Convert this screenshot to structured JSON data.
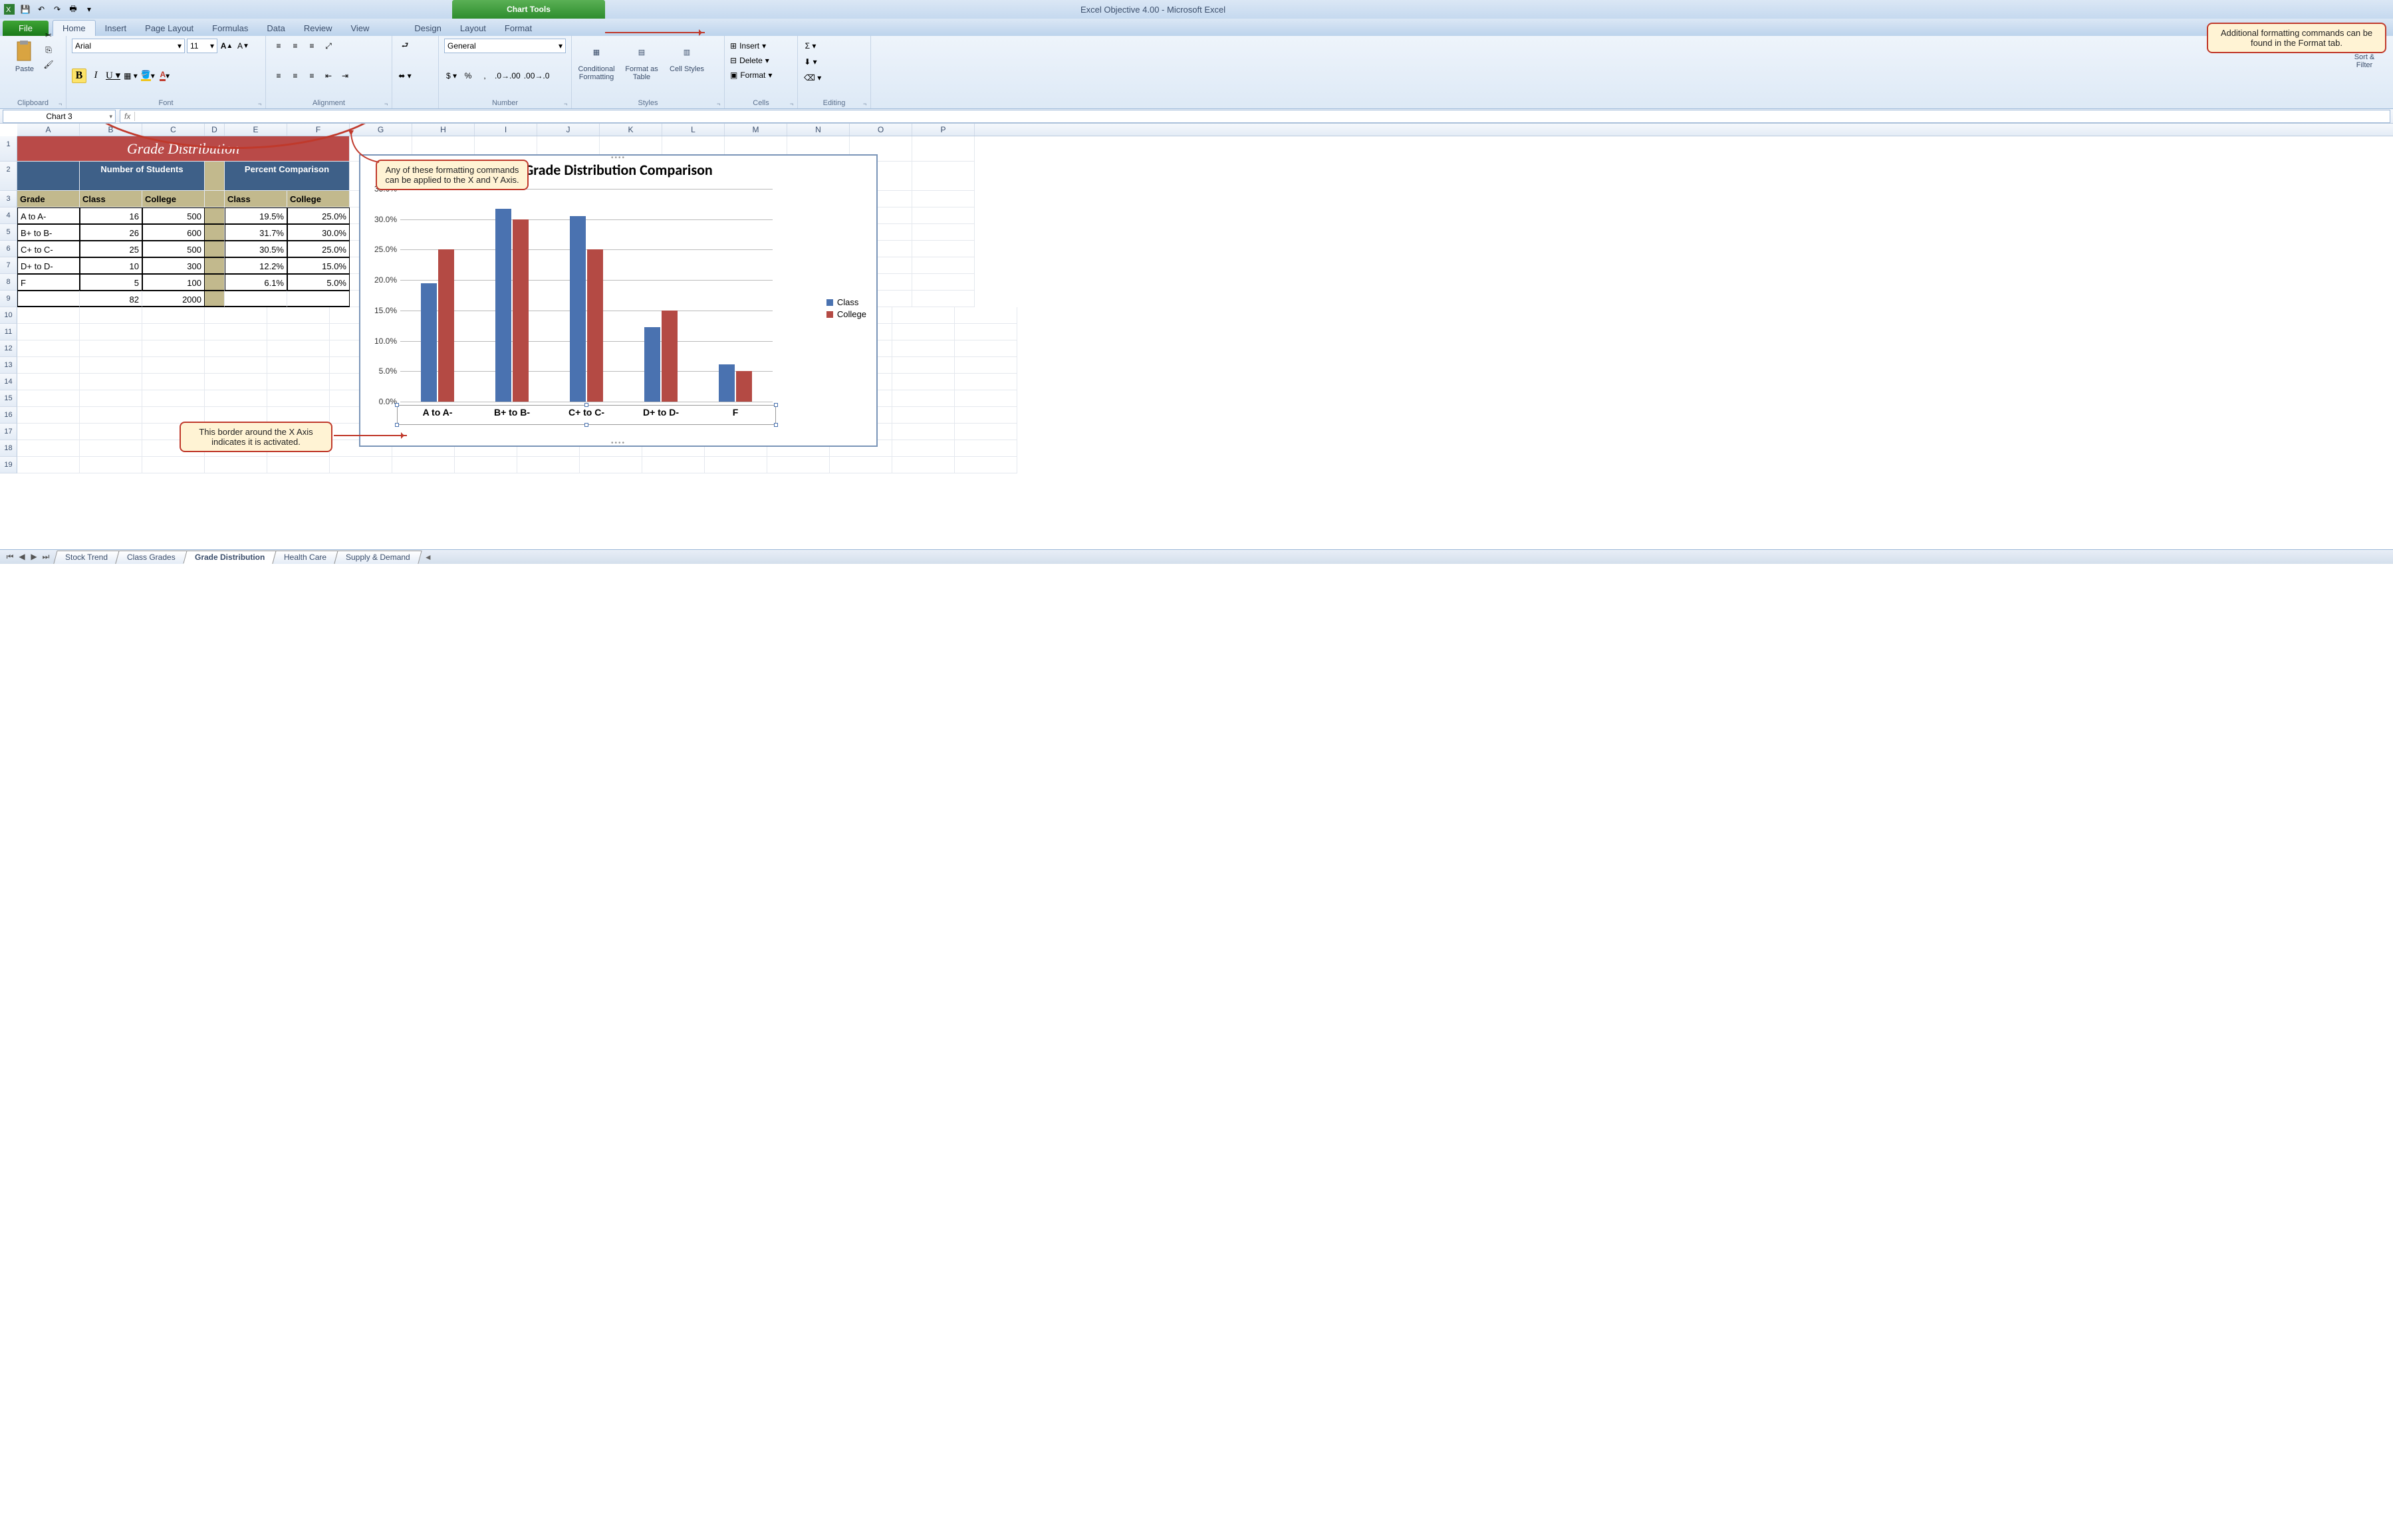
{
  "app": {
    "title": "Excel Objective 4.00  -  Microsoft Excel",
    "contextual_tab_group": "Chart Tools"
  },
  "qat": {
    "save": "💾",
    "undo": "↶",
    "redo": "↷",
    "print": "🖶"
  },
  "tabs": {
    "file": "File",
    "home": "Home",
    "insert": "Insert",
    "page_layout": "Page Layout",
    "formulas": "Formulas",
    "data": "Data",
    "review": "Review",
    "view": "View",
    "design": "Design",
    "layout": "Layout",
    "format": "Format"
  },
  "ribbon": {
    "clipboard": {
      "paste": "Paste",
      "label": "Clipboard"
    },
    "font": {
      "name": "Arial",
      "size": "11",
      "label": "Font"
    },
    "alignment": {
      "label": "Alignment"
    },
    "number": {
      "format": "General",
      "label": "Number"
    },
    "styles": {
      "cf": "Conditional Formatting",
      "fat": "Format as Table",
      "cs": "Cell Styles",
      "label": "Styles"
    },
    "cells": {
      "insert": "Insert",
      "delete": "Delete",
      "format": "Format",
      "label": "Cells"
    },
    "editing": {
      "sort": "Sort & Filter",
      "label": "Editing"
    }
  },
  "namebox": "Chart 3",
  "cols": [
    "A",
    "B",
    "C",
    "D",
    "E",
    "F",
    "G",
    "H",
    "I",
    "J",
    "K",
    "L",
    "M",
    "N",
    "O",
    "P"
  ],
  "table": {
    "title": "Grade Distribution",
    "hdr_num": "Number of Students",
    "hdr_pct": "Percent Comparison",
    "sub": {
      "grade": "Grade",
      "class": "Class",
      "college": "College"
    },
    "rows": [
      {
        "g": "A to A-",
        "nc": "16",
        "ncol": "500",
        "pc": "19.5%",
        "pcol": "25.0%"
      },
      {
        "g": "B+ to B-",
        "nc": "26",
        "ncol": "600",
        "pc": "31.7%",
        "pcol": "30.0%"
      },
      {
        "g": "C+ to C-",
        "nc": "25",
        "ncol": "500",
        "pc": "30.5%",
        "pcol": "25.0%"
      },
      {
        "g": "D+ to D-",
        "nc": "10",
        "ncol": "300",
        "pc": "12.2%",
        "pcol": "15.0%"
      },
      {
        "g": "F",
        "nc": "5",
        "ncol": "100",
        "pc": "6.1%",
        "pcol": "5.0%"
      }
    ],
    "total": {
      "nc": "82",
      "ncol": "2000"
    }
  },
  "chart_data": {
    "type": "bar",
    "title": "Grade Distribution  Comparison",
    "categories": [
      "A to A-",
      "B+ to B-",
      "C+ to C-",
      "D+ to D-",
      "F"
    ],
    "series": [
      {
        "name": "Class",
        "values": [
          19.5,
          31.7,
          30.5,
          12.2,
          6.1
        ]
      },
      {
        "name": "College",
        "values": [
          25.0,
          30.0,
          25.0,
          15.0,
          5.0
        ]
      }
    ],
    "ylim": [
      0,
      35
    ],
    "ystep": 5,
    "yticks": [
      "0.0%",
      "5.0%",
      "10.0%",
      "15.0%",
      "20.0%",
      "25.0%",
      "30.0%",
      "35.0%"
    ],
    "colors": [
      "#4a72b0",
      "#b44a44"
    ]
  },
  "callouts": {
    "c1": "Additional formatting commands can be found in the Format tab.",
    "c2": "Any of these formatting commands can be applied to the X and Y Axis.",
    "c3": "This border around the X Axis indicates it is activated."
  },
  "sheets": {
    "tabs": [
      "Stock Trend",
      "Class Grades",
      "Grade Distribution",
      "Health Care",
      "Supply & Demand"
    ],
    "active": 2
  }
}
